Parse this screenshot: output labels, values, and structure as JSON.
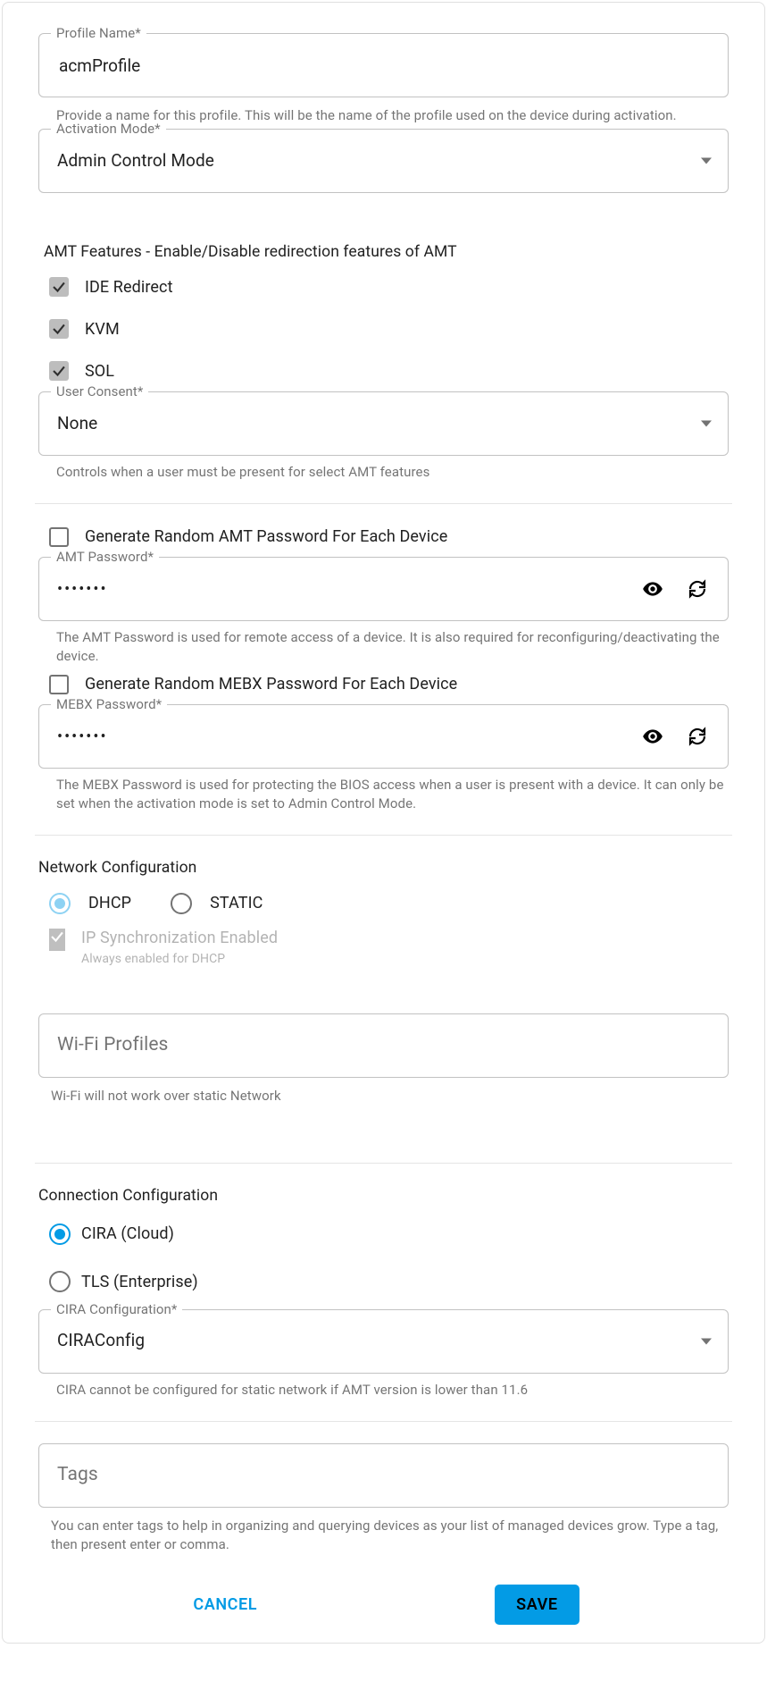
{
  "profile_name": {
    "label": "Profile Name*",
    "value": "acmProfile",
    "hint": "Provide a name for this profile. This will be the name of the profile used on the device during activation."
  },
  "activation_mode": {
    "label": "Activation Mode*",
    "value": "Admin Control Mode"
  },
  "amt_features": {
    "title": "AMT Features - Enable/Disable redirection features of AMT",
    "ide_redirect": {
      "label": "IDE Redirect",
      "checked": true
    },
    "kvm": {
      "label": "KVM",
      "checked": true
    },
    "sol": {
      "label": "SOL",
      "checked": true
    }
  },
  "user_consent": {
    "label": "User Consent*",
    "value": "None",
    "hint": "Controls when a user must be present for select AMT features"
  },
  "amt_password": {
    "gen_random_label": "Generate Random AMT Password For Each Device",
    "gen_random_checked": false,
    "label": "AMT Password*",
    "value": "•••••••",
    "hint": "The AMT Password is used for remote access of a device. It is also required for reconfiguring/deactivating the device."
  },
  "mebx_password": {
    "gen_random_label": "Generate Random MEBX Password For Each Device",
    "gen_random_checked": false,
    "label": "MEBX Password*",
    "value": "•••••••",
    "hint": "The MEBX Password is used for protecting the BIOS access when a user is present with a device. It can only be set when the activation mode is set to Admin Control Mode."
  },
  "network": {
    "title": "Network Configuration",
    "dhcp_label": "DHCP",
    "static_label": "STATIC",
    "selected": "DHCP",
    "ipsync_title": "IP Synchronization Enabled",
    "ipsync_sub": "Always enabled for DHCP",
    "wifi_placeholder": "Wi-Fi Profiles",
    "wifi_hint": "Wi-Fi will not work over static Network"
  },
  "connection": {
    "title": "Connection Configuration",
    "cira_label": "CIRA (Cloud)",
    "tls_label": "TLS (Enterprise)",
    "selected": "CIRA",
    "cira_config_label": "CIRA Configuration*",
    "cira_config_value": "CIRAConfig",
    "cira_hint": "CIRA cannot be configured for static network if AMT version is lower than 11.6"
  },
  "tags": {
    "placeholder": "Tags",
    "hint": "You can enter tags to help in organizing and querying devices as your list of managed devices grow. Type a tag, then present enter or comma."
  },
  "footer": {
    "cancel": "CANCEL",
    "save": "SAVE"
  }
}
